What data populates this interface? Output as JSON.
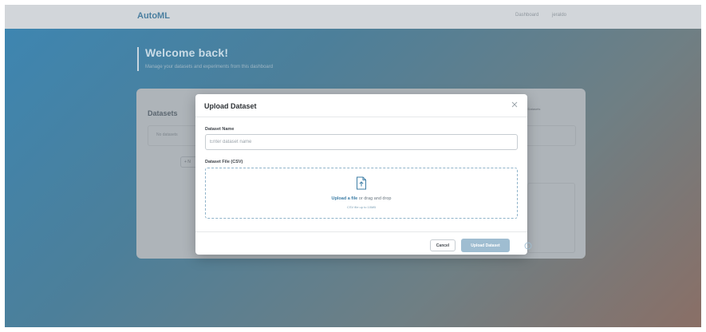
{
  "navbar": {
    "brand": "AutoML",
    "links": [
      "Dashboard",
      "jeraldo"
    ]
  },
  "hero": {
    "title": "Welcome back!",
    "subtitle": "Manage your datasets and experiments from this dashboard"
  },
  "background_card": {
    "title": "Datasets",
    "select_value": "All Datasets",
    "empty_text": "No datasets",
    "button_label": "+ N"
  },
  "modal": {
    "title": "Upload Dataset",
    "name_field": {
      "label": "Dataset Name",
      "placeholder": "Enter dataset name",
      "value": ""
    },
    "file_field": {
      "label": "Dataset File (CSV)",
      "link_text": "Upload a file",
      "drop_text": " or drag and drop",
      "hint": "CSV file up to 10MB"
    },
    "cancel_label": "Cancel",
    "submit_label": "Upload Dataset"
  },
  "icons": {
    "close": "close-icon",
    "upload": "file-upload-icon",
    "help": "info-circle-icon"
  },
  "colors": {
    "accent": "#3e7ea6",
    "submit_disabled": "#9fbdd1",
    "dropzone_border": "#8fb3ca"
  }
}
